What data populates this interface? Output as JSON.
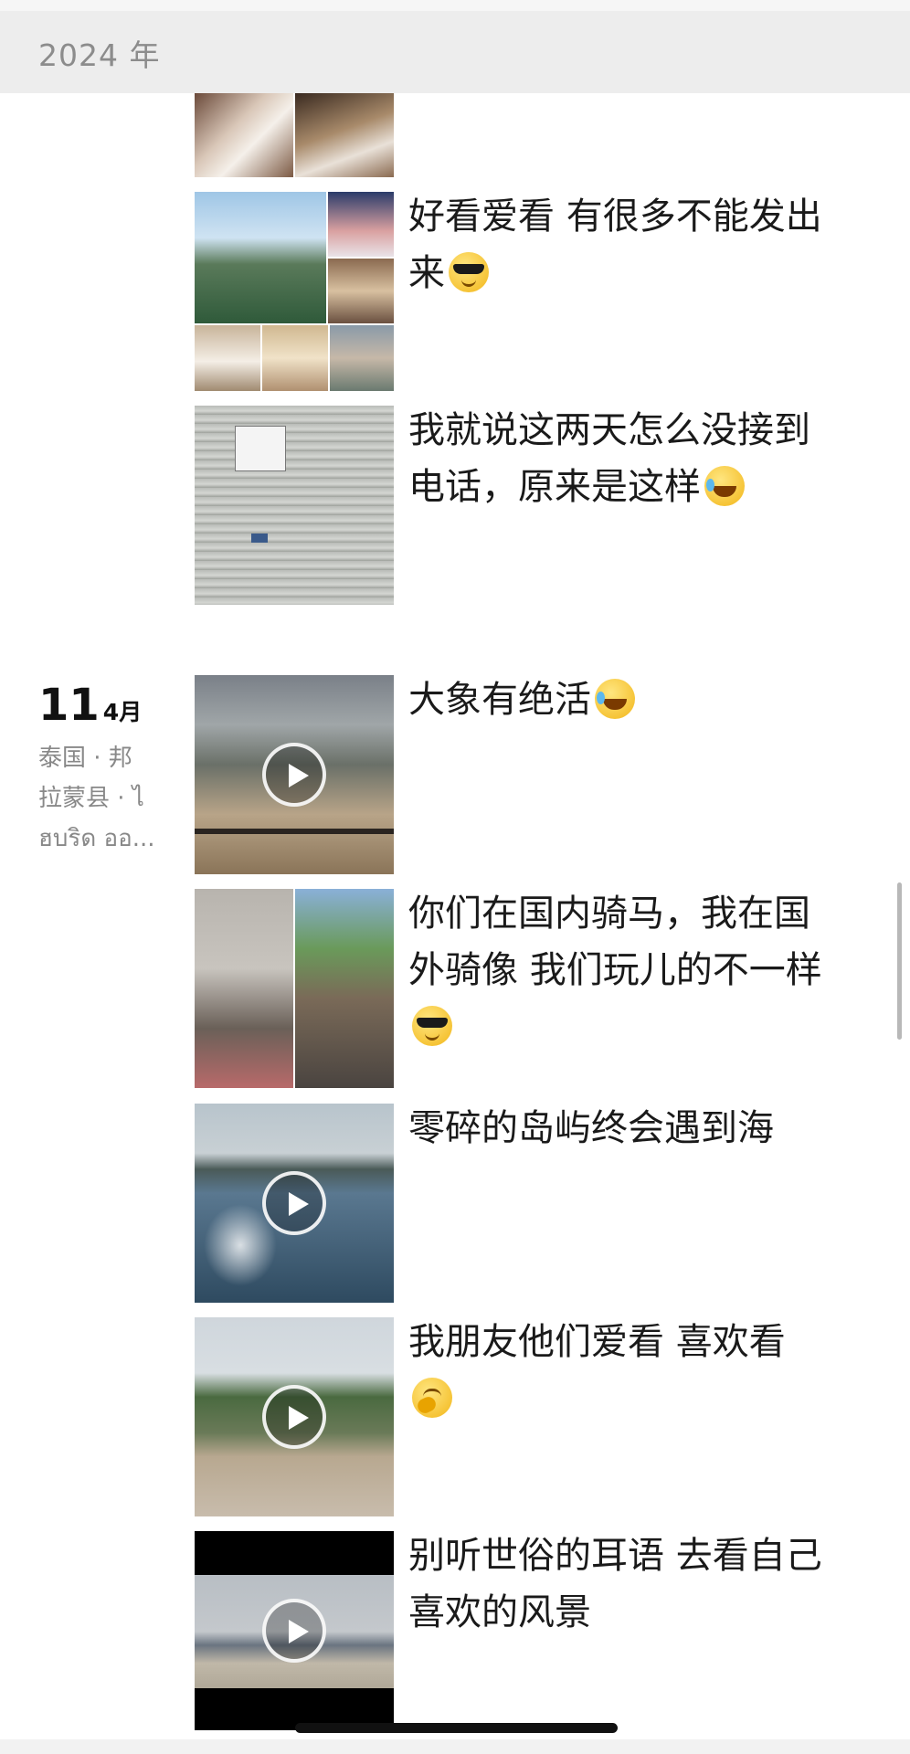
{
  "header": {
    "year": "2024 年"
  },
  "posts_prev": [
    {
      "text": "好看爱看 有很多不能发出来",
      "emoji": "cool-sunglasses-emoji"
    },
    {
      "text": "我就说这两天怎么没接到电话，原来是这样",
      "emoji": "laughing-crying-emoji"
    }
  ],
  "date_group": {
    "day": "11",
    "month": "4月",
    "location": "泰国 · 邦\n拉蒙县 · ไ\nฮบริด ออ..."
  },
  "posts_apr11": [
    {
      "text": "大象有绝活",
      "emoji": "laughing-crying-emoji",
      "type": "video"
    },
    {
      "text": "你们在国内骑马，我在国外骑像 我们玩儿的不一样",
      "emoji": "cool-sunglasses-emoji",
      "type": "photos"
    },
    {
      "text": "零碎的岛屿终会遇到海",
      "type": "video"
    },
    {
      "text": "我朋友他们爱看 喜欢看",
      "emoji": "hugging-emoji",
      "type": "video"
    },
    {
      "text": "别听世俗的耳语 去看自己喜欢的风景",
      "type": "video"
    }
  ],
  "colors": {
    "header_bg": "#ededed",
    "text": "#1a1a1a",
    "secondary": "#888888"
  }
}
